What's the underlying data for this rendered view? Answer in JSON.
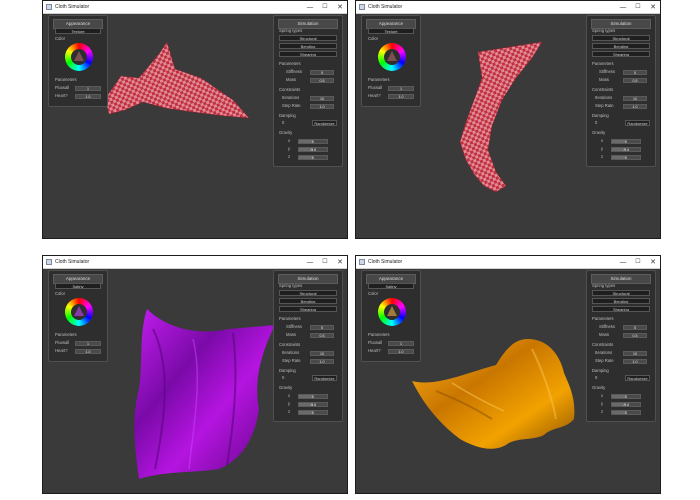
{
  "app_title": "Cloth Simulator",
  "window_controls": {
    "minimize": "—",
    "maximize": "☐",
    "close": "✕"
  },
  "appearance": {
    "header": "Appearance",
    "texture_label": "Texture",
    "texture_value": "Satiny",
    "color_label": "Color",
    "parameters_label": "Parameters",
    "param1_label": "Fluxsall",
    "param1_value": "1",
    "param2_label": "Heart?",
    "param2_value": "1.0"
  },
  "simulation": {
    "header": "Simulation",
    "spring_types_label": "Spring types",
    "spring_types": [
      "Structural",
      "Bending",
      "Shearing"
    ],
    "parameters_label": "Parameters",
    "stiffness_label": "Stiffness",
    "stiffness_value": "5",
    "mass_label": "Mass",
    "mass_value": "0.5",
    "constraints_label": "Constraints",
    "iterations_label": "Iterations",
    "iterations_value": "10",
    "step_label": "Step Rate",
    "step_value": "1.0",
    "damping_label": "Damping",
    "damping_value": "0",
    "damping_button": "Randomize",
    "gravity_label": "Gravity",
    "gravity": [
      {
        "axis": "x",
        "value": "0"
      },
      {
        "axis": "y",
        "value": "-9.8"
      },
      {
        "axis": "z",
        "value": "0"
      }
    ],
    "gravity_level": 0.5
  },
  "windows": [
    {
      "id": "checker-flag",
      "texture_value": "Texture",
      "cloth_color": "#c0303f",
      "pattern": "checker"
    },
    {
      "id": "checker-drape",
      "texture_value": "Texture",
      "cloth_color": "#c0303f",
      "pattern": "checker"
    },
    {
      "id": "purple-silk",
      "texture_value": "Satiny",
      "cloth_color": "#9a12c8",
      "pattern": "solid"
    },
    {
      "id": "gold-silk",
      "texture_value": "Satiny",
      "cloth_color": "#d98a00",
      "pattern": "solid"
    }
  ]
}
